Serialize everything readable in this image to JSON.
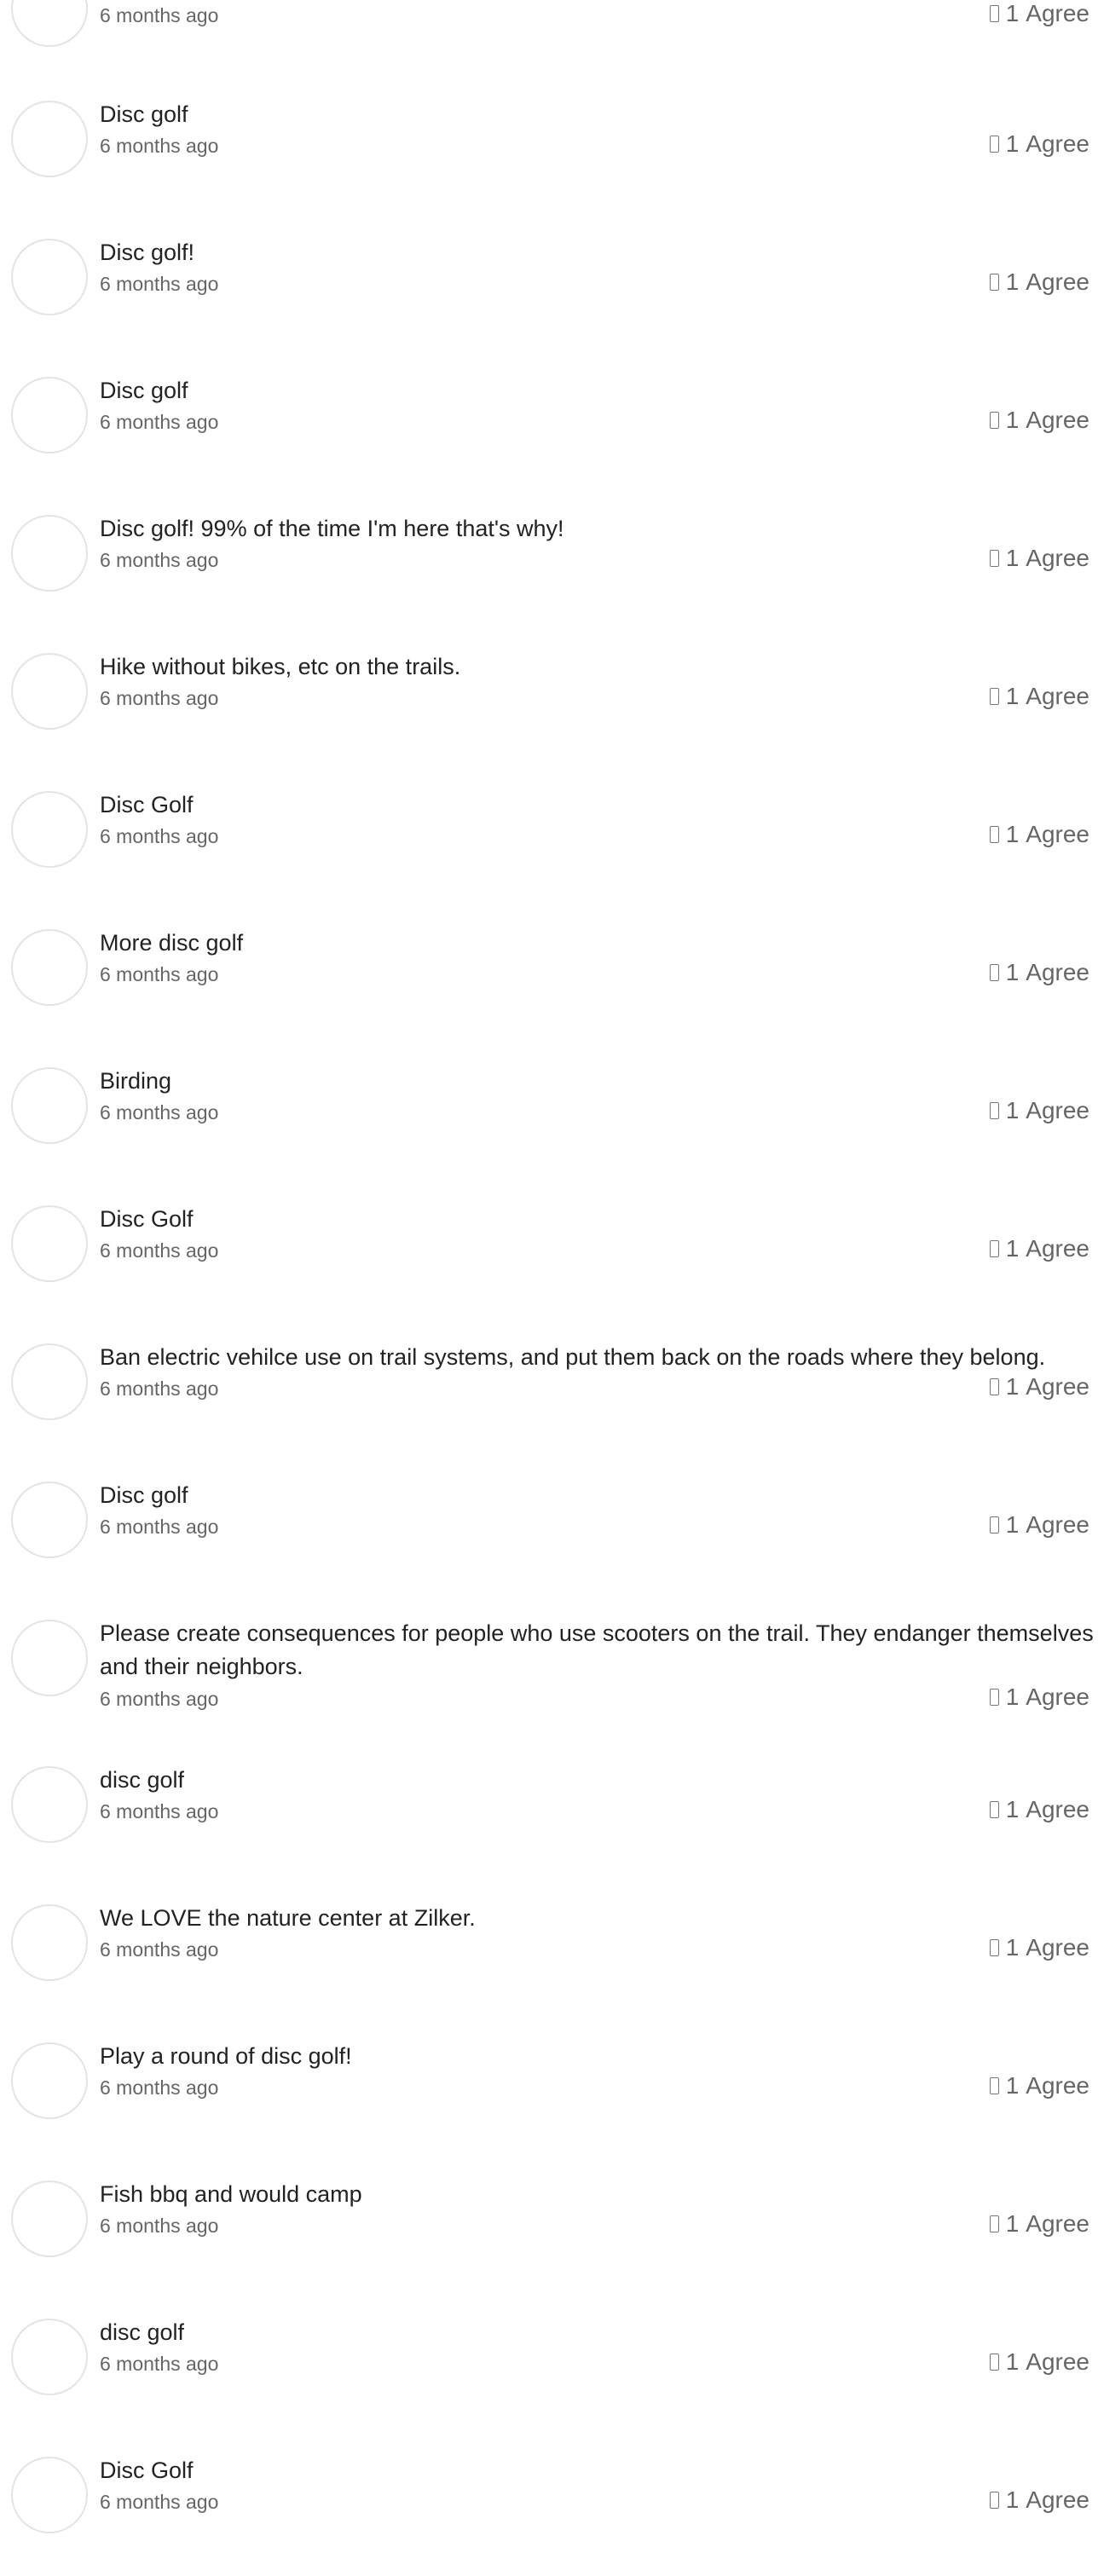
{
  "comments": [
    {
      "text": "",
      "time": "6 months ago",
      "agree_count": "1",
      "agree_label": "Agree"
    },
    {
      "text": "Disc golf",
      "time": "6 months ago",
      "agree_count": "1",
      "agree_label": "Agree"
    },
    {
      "text": "Disc golf!",
      "time": "6 months ago",
      "agree_count": "1",
      "agree_label": "Agree"
    },
    {
      "text": "Disc golf",
      "time": "6 months ago",
      "agree_count": "1",
      "agree_label": "Agree"
    },
    {
      "text": "Disc golf! 99% of the time I'm here that's why!",
      "time": "6 months ago",
      "agree_count": "1",
      "agree_label": "Agree"
    },
    {
      "text": "Hike without bikes, etc on the trails.",
      "time": "6 months ago",
      "agree_count": "1",
      "agree_label": "Agree"
    },
    {
      "text": "Disc Golf",
      "time": "6 months ago",
      "agree_count": "1",
      "agree_label": "Agree"
    },
    {
      "text": "More disc golf",
      "time": "6 months ago",
      "agree_count": "1",
      "agree_label": "Agree"
    },
    {
      "text": "Birding",
      "time": "6 months ago",
      "agree_count": "1",
      "agree_label": "Agree"
    },
    {
      "text": "Disc Golf",
      "time": "6 months ago",
      "agree_count": "1",
      "agree_label": "Agree"
    },
    {
      "text": "Ban electric vehilce use on trail systems, and put them back on the roads where they belong.",
      "time": "6 months ago",
      "agree_count": "1",
      "agree_label": "Agree"
    },
    {
      "text": "Disc golf",
      "time": "6 months ago",
      "agree_count": "1",
      "agree_label": "Agree"
    },
    {
      "text": "Please create consequences for people who use scooters on the trail. They endanger themselves and their neighbors.",
      "time": "6 months ago",
      "agree_count": "1",
      "agree_label": "Agree"
    },
    {
      "text": "disc golf",
      "time": "6 months ago",
      "agree_count": "1",
      "agree_label": "Agree"
    },
    {
      "text": "We LOVE the nature center at Zilker.",
      "time": "6 months ago",
      "agree_count": "1",
      "agree_label": "Agree"
    },
    {
      "text": "Play a round of disc golf!",
      "time": "6 months ago",
      "agree_count": "1",
      "agree_label": "Agree"
    },
    {
      "text": "Fish bbq and would camp",
      "time": "6 months ago",
      "agree_count": "1",
      "agree_label": "Agree"
    },
    {
      "text": "disc golf",
      "time": "6 months ago",
      "agree_count": "1",
      "agree_label": "Agree"
    },
    {
      "text": "Disc Golf",
      "time": "6 months ago",
      "agree_count": "1",
      "agree_label": "Agree"
    }
  ],
  "icons": {
    "agree": "thumbs-up-icon"
  },
  "colors": {
    "text": "#222222",
    "muted": "#666666",
    "avatar_border": "#e4e4e4"
  }
}
